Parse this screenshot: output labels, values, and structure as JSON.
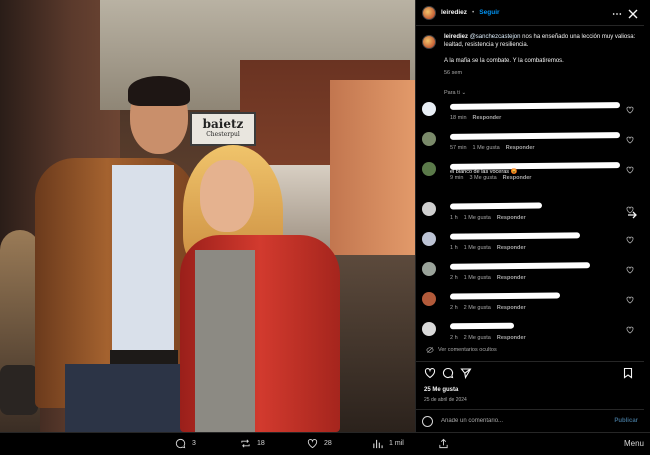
{
  "post": {
    "username": "leirediez",
    "separator": "•",
    "follow_label": "Seguir",
    "caption_mention": "@sanchezcastejon",
    "caption_text": " nos ha enseñado una lección muy valiosa: lealtad, resistencia y resiliencia.",
    "caption_line2": "A la mafia se la combate. Y la combatiremos.",
    "caption_time": "56 sem",
    "for_you_label": "Para ti",
    "likes": "25 Me gusta",
    "date": "25 de abril de 2024",
    "comment_placeholder": "Añade un comentario...",
    "publish_label": "Publicar",
    "hidden_comments_label": "Ver comentarios ocultos"
  },
  "photo": {
    "sign_title": "baietz",
    "sign_subtitle": "Chesterpul"
  },
  "comments": [
    {
      "time": "18 min",
      "likes": "",
      "reply": "Responder",
      "avatar_color": "#e8eef5",
      "redact_w": 170,
      "redact2_w": 0
    },
    {
      "time": "57 min",
      "likes": "1 Me gusta",
      "reply": "Responder",
      "avatar_color": "#7a8a6a",
      "redact_w": 170,
      "redact2_w": 0
    },
    {
      "time": "9 min",
      "likes": "3 Me gusta",
      "reply": "Responder",
      "avatar_color": "#5b7a4a",
      "redact_w": 170,
      "redact2_w": 0,
      "text": "el blanco de las voceras 😡"
    },
    {
      "time": "1 h",
      "likes": "1 Me gusta",
      "reply": "Responder",
      "avatar_color": "#cfcfcf",
      "redact_w": 92,
      "redact2_w": 0
    },
    {
      "time": "1 h",
      "likes": "1 Me gusta",
      "reply": "Responder",
      "avatar_color": "#bcc3d4",
      "redact_w": 130,
      "redact2_w": 0
    },
    {
      "time": "2 h",
      "likes": "1 Me gusta",
      "reply": "Responder",
      "avatar_color": "#9aa39a",
      "redact_w": 140,
      "redact2_w": 0
    },
    {
      "time": "2 h",
      "likes": "2 Me gusta",
      "reply": "Responder",
      "avatar_color": "#b25a3a",
      "redact_w": 110,
      "redact2_w": 0
    },
    {
      "time": "2 h",
      "likes": "2 Me gusta",
      "reply": "Responder",
      "avatar_color": "#d9d9d9",
      "redact_w": 64,
      "redact2_w": 0
    }
  ],
  "stats": {
    "replies": "3",
    "reposts": "18",
    "likes": "28",
    "views": "1 mil",
    "more": "Menu"
  },
  "colors": {
    "accent": "#0095f6",
    "panel_bg": "#000000",
    "muted": "#a8a8a8"
  },
  "icons": [
    "more-icon",
    "close-icon",
    "heart-icon",
    "comment-icon",
    "share-icon",
    "bookmark-icon",
    "emoji-icon",
    "repost-icon",
    "views-icon",
    "upload-icon",
    "next-arrow-icon"
  ]
}
